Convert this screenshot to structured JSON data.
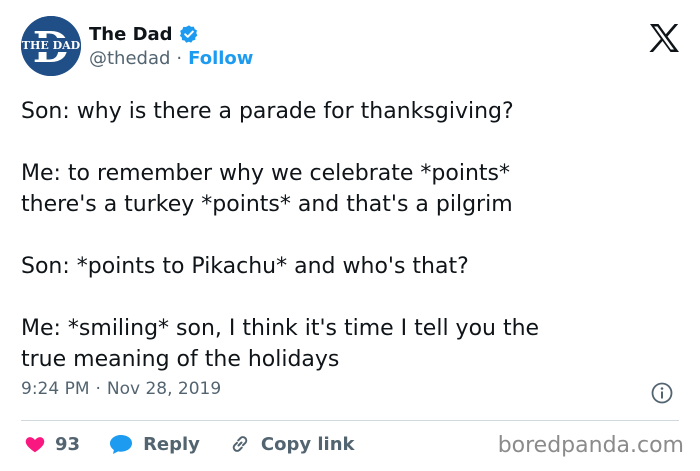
{
  "author": {
    "display_name": "The Dad",
    "handle": "@thedad",
    "separator": "·",
    "follow_label": "Follow",
    "avatar_text": "THE DAD",
    "avatar_letter": "D"
  },
  "tweet": {
    "paragraphs": [
      "Son: why is there a parade for thanksgiving?",
      "Me: to remember why we celebrate *points*\nthere's a turkey *points* and that's a pilgrim",
      "Son: *points to Pikachu* and who's that?",
      "Me: *smiling* son, I think it's time I tell you the\ntrue meaning of the holidays"
    ],
    "time": "9:24 PM",
    "date_separator": "·",
    "date": "Nov 28, 2019"
  },
  "actions": {
    "like_count": "93",
    "reply_label": "Reply",
    "copy_label": "Copy link"
  },
  "watermark": "boredpanda.com",
  "colors": {
    "accent": "#1d9bf0",
    "like": "#f91880",
    "muted": "#536471",
    "avatar_bg": "#1f4f86"
  },
  "icons": {
    "verified": "verified-badge-icon",
    "platform": "x-logo-icon",
    "info": "info-icon",
    "like": "heart-icon",
    "reply": "reply-bubble-icon",
    "copy": "link-icon"
  }
}
